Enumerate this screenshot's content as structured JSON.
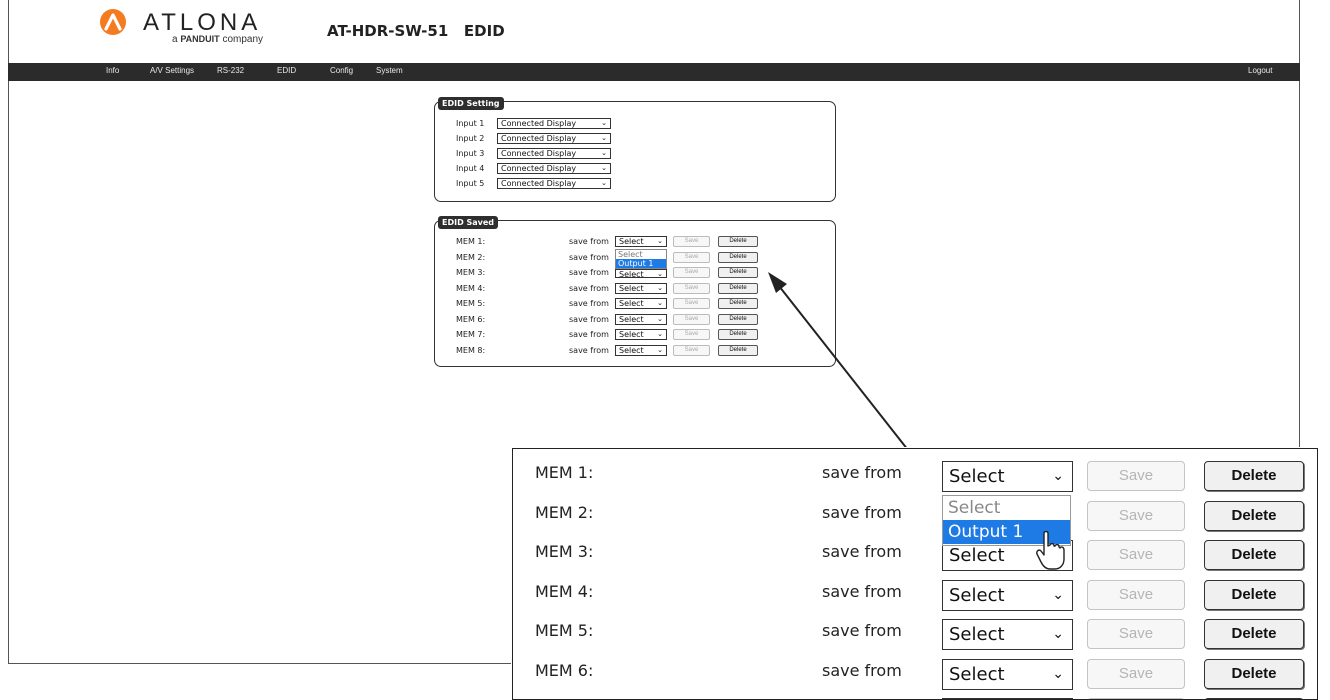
{
  "brand": {
    "name": "ATLONA",
    "tagline_prefix": "a",
    "tagline_brand": "PANDUIT",
    "tagline_suffix": "company",
    "accent": "#f47b20"
  },
  "page_title": "AT-HDR-SW-51   EDID",
  "nav": {
    "items": [
      "Info",
      "A/V Settings",
      "RS-232",
      "EDID",
      "Config",
      "System"
    ],
    "logout": "Logout"
  },
  "edid_setting": {
    "legend": "EDID Setting",
    "rows": [
      {
        "label": "Input 1",
        "value": "Connected Display"
      },
      {
        "label": "Input 2",
        "value": "Connected Display"
      },
      {
        "label": "Input 3",
        "value": "Connected Display"
      },
      {
        "label": "Input 4",
        "value": "Connected Display"
      },
      {
        "label": "Input 5",
        "value": "Connected Display"
      }
    ]
  },
  "edid_saved": {
    "legend": "EDID Saved",
    "save_from": "save from",
    "save_label": "Save",
    "delete_label": "Delete",
    "rows": [
      {
        "label": "MEM 1:",
        "value": "Select"
      },
      {
        "label": "MEM 2:",
        "value": "Select"
      },
      {
        "label": "MEM 3:",
        "value": "Select"
      },
      {
        "label": "MEM 4:",
        "value": "Select"
      },
      {
        "label": "MEM 5:",
        "value": "Select"
      },
      {
        "label": "MEM 6:",
        "value": "Select"
      },
      {
        "label": "MEM 7:",
        "value": "Select"
      },
      {
        "label": "MEM 8:",
        "value": "Select"
      }
    ],
    "dropdown_options": [
      "Select",
      "Output 1"
    ],
    "dropdown_highlighted": "Output 1"
  },
  "colors": {
    "navbar": "#2b2b2b",
    "legend_bg": "#2e2e2e",
    "highlight": "#1e7be6"
  }
}
